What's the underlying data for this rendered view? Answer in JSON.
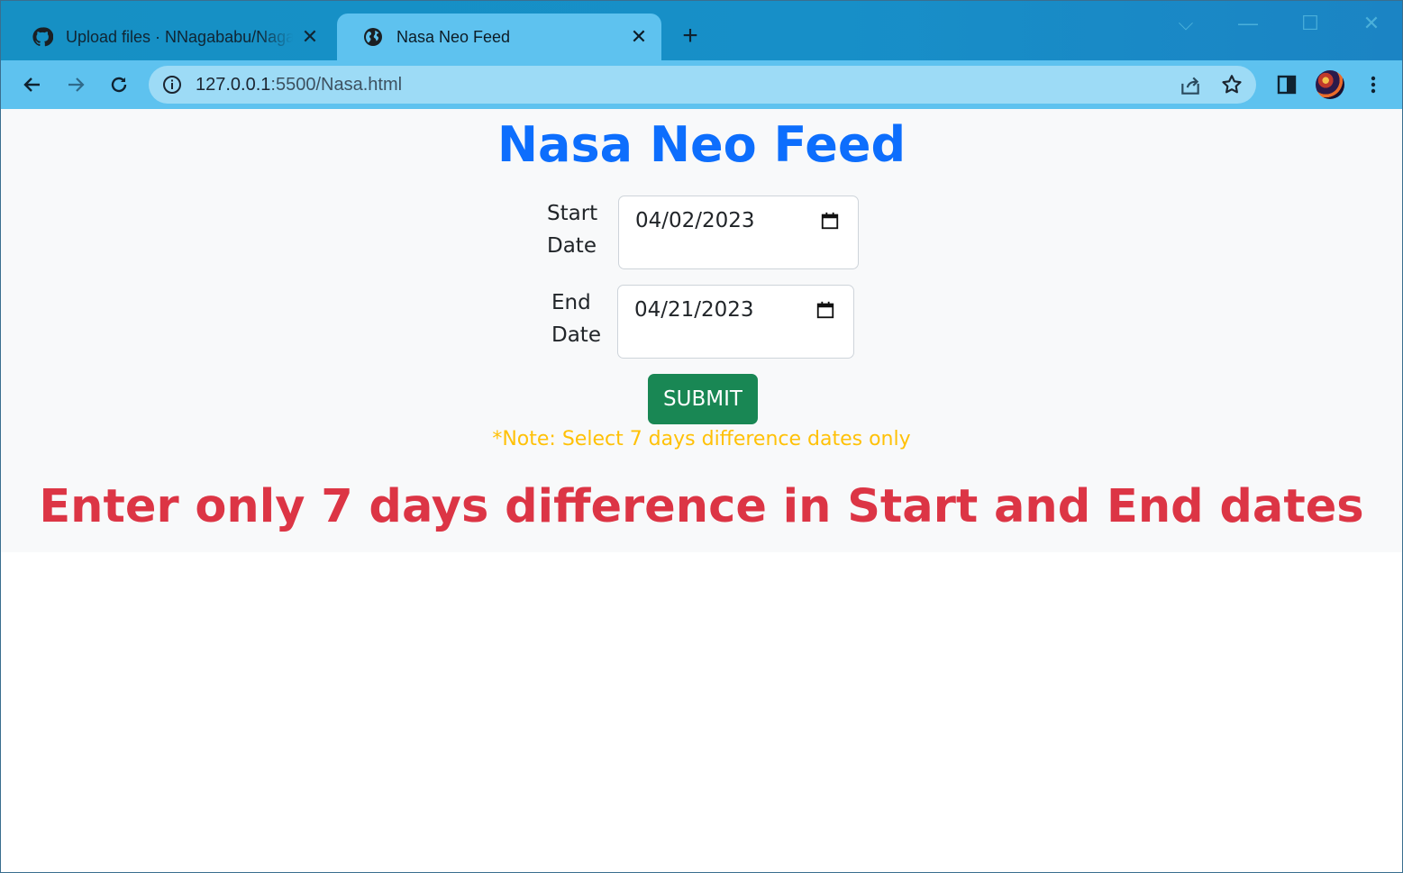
{
  "browser": {
    "tabs": [
      {
        "title": "Upload files · NNagababu/NagaNNagababu",
        "active": false,
        "icon": "github-icon"
      },
      {
        "title": "Nasa Neo Feed",
        "active": true,
        "icon": "globe-icon"
      }
    ],
    "new_tab_label": "+",
    "close_glyph": "✕",
    "url_host": "127.0.0.1",
    "url_path": ":5500/Nasa.html"
  },
  "page": {
    "heading": "Nasa Neo Feed",
    "start_label_1": "Start",
    "start_label_2": "Date",
    "start_value": "04/02/2023",
    "end_label_1": "End",
    "end_label_2": "Date",
    "end_value": "04/21/2023",
    "submit_label": "SUBMIT",
    "note": "*Note: Select 7 days difference dates only",
    "error_message": "Enter only 7 days difference in Start and End dates"
  },
  "colors": {
    "heading": "#0d6efd",
    "submit": "#198754",
    "note": "#ffc107",
    "error": "#dc3545"
  }
}
